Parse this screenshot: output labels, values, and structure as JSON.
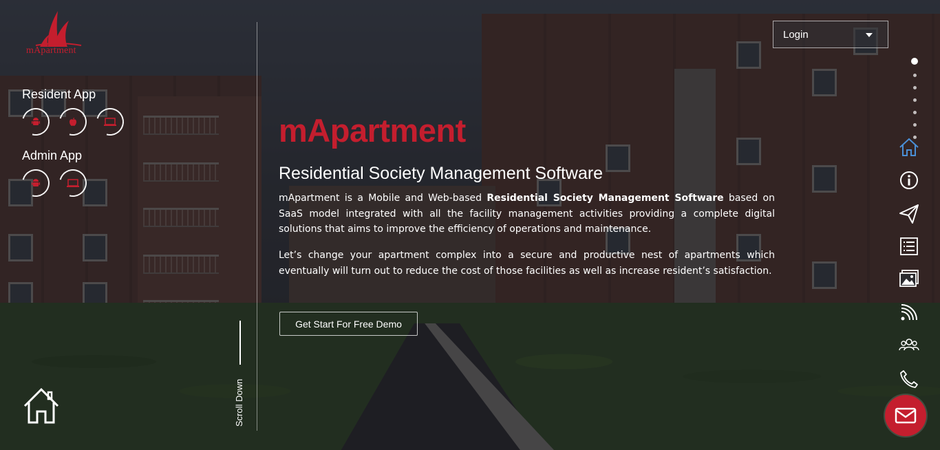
{
  "brand": {
    "logo_text": "mApartment",
    "accent_color": "#c41e2e"
  },
  "left_panel": {
    "resident_heading": "Resident App",
    "resident_icons": [
      "android-icon",
      "apple-icon",
      "desktop-icon"
    ],
    "admin_heading": "Admin App",
    "admin_icons": [
      "android-icon",
      "desktop-icon"
    ],
    "scroll_label": "Scroll Down"
  },
  "header": {
    "login_label": "Login"
  },
  "hero": {
    "title": "mApartment",
    "subtitle": "Residential Society Management Software",
    "para1_a": "mApartment is a Mobile and Web-based ",
    "para1_bold": "Residential Society Management Software",
    "para1_b": " based on SaaS model integrated with all the facility management activities providing a complete digital solutions that aims to improve the efficiency of operations and maintenance.",
    "para2": "Let’s change your apartment complex into a secure and productive nest of apartments which eventually will turn out to reduce the cost of those facilities as well as increase resident’s satisfaction.",
    "cta_label": "Get Start For Free Demo"
  },
  "right_nav": {
    "dots_count": 7,
    "active_dot": 0,
    "items": [
      "home-icon",
      "info-icon",
      "paper-plane-icon",
      "list-icon",
      "gallery-icon",
      "rss-icon",
      "users-icon",
      "phone-icon"
    ],
    "active_item": "home-icon",
    "active_color": "#4a8fd6"
  },
  "fab": {
    "icon": "mail-icon"
  }
}
